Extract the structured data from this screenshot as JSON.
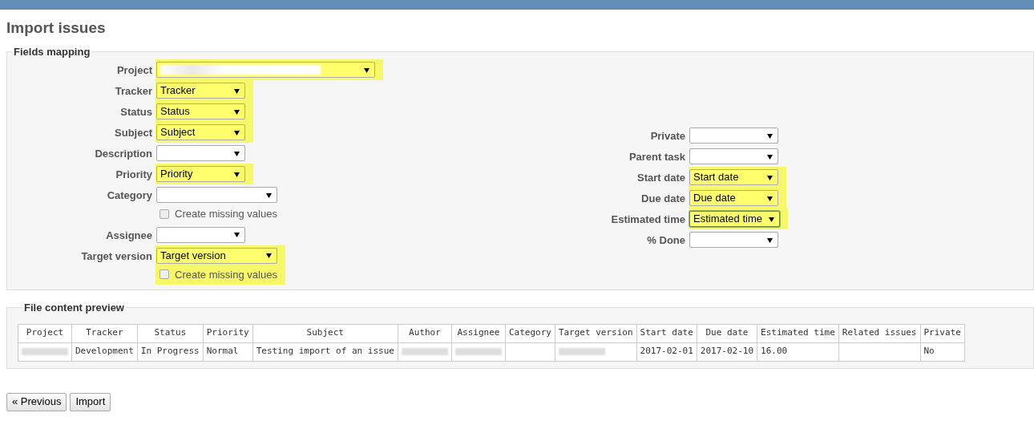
{
  "title": "Import issues",
  "fields_mapping": {
    "legend": "Fields mapping",
    "left": [
      {
        "label": "Project",
        "kind": "redacted",
        "highlighted": true
      },
      {
        "label": "Tracker",
        "value": "Tracker",
        "highlighted": true
      },
      {
        "label": "Status",
        "value": "Status",
        "highlighted": true
      },
      {
        "label": "Subject",
        "value": "Subject",
        "highlighted": true
      },
      {
        "label": "Description",
        "highlighted": false
      },
      {
        "label": "Priority",
        "value": "Priority",
        "highlighted": true
      },
      {
        "label": "Category",
        "highlighted": false,
        "create_missing": {
          "label": "Create missing values",
          "checked": false
        }
      },
      {
        "label": "Assignee",
        "highlighted": false
      },
      {
        "label": "Target version",
        "value": "Target version",
        "highlighted": true,
        "create_missing": {
          "label": "Create missing values",
          "checked": false
        }
      }
    ],
    "right": [
      {
        "label": "Private",
        "highlighted": false
      },
      {
        "label": "Parent task",
        "highlighted": false
      },
      {
        "label": "Start date",
        "value": "Start date",
        "highlighted": true
      },
      {
        "label": "Due date",
        "value": "Due date",
        "highlighted": true
      },
      {
        "label": "Estimated time",
        "value": "Estimated time",
        "highlighted": true,
        "focused": true
      },
      {
        "label": "% Done",
        "highlighted": false
      }
    ]
  },
  "preview": {
    "legend": "File content preview",
    "columns": [
      "Project",
      "Tracker",
      "Status",
      "Priority",
      "Subject",
      "Author",
      "Assignee",
      "Category",
      "Target version",
      "Start date",
      "Due date",
      "Estimated time",
      "Related issues",
      "Private"
    ],
    "rows": [
      [
        {
          "kind": "redacted"
        },
        {
          "kind": "text",
          "text": "Development"
        },
        {
          "kind": "text",
          "text": "In Progress"
        },
        {
          "kind": "text",
          "text": "Normal"
        },
        {
          "kind": "text",
          "text": "Testing import of an issue"
        },
        {
          "kind": "redacted"
        },
        {
          "kind": "redacted"
        },
        {
          "kind": "blank"
        },
        {
          "kind": "redacted"
        },
        {
          "kind": "text",
          "text": "2017-02-01"
        },
        {
          "kind": "text",
          "text": "2017-02-10"
        },
        {
          "kind": "text",
          "text": "16.00"
        },
        {
          "kind": "blank"
        },
        {
          "kind": "text",
          "text": "No"
        }
      ]
    ]
  },
  "buttons": [
    "« Previous",
    "Import"
  ]
}
